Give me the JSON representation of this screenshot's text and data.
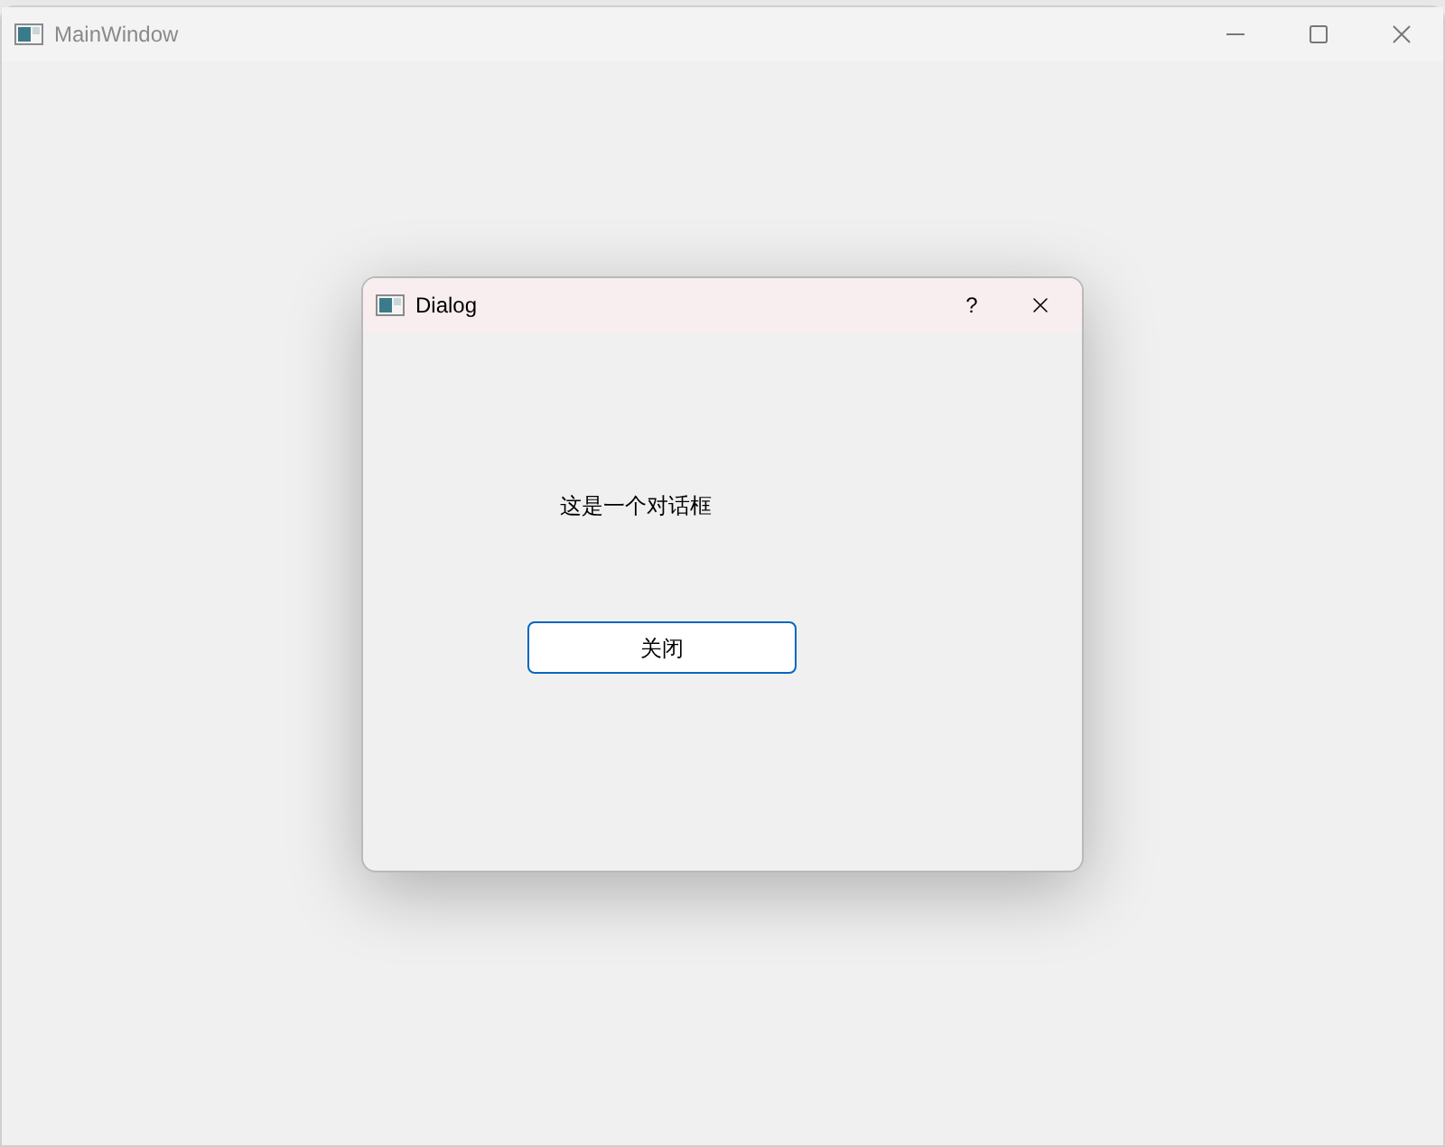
{
  "window": {
    "title": "MainWindow"
  },
  "dialog": {
    "title": "Dialog",
    "help": "?",
    "message": "这是一个对话框",
    "button": {
      "label": "关闭",
      "focused": true
    }
  }
}
